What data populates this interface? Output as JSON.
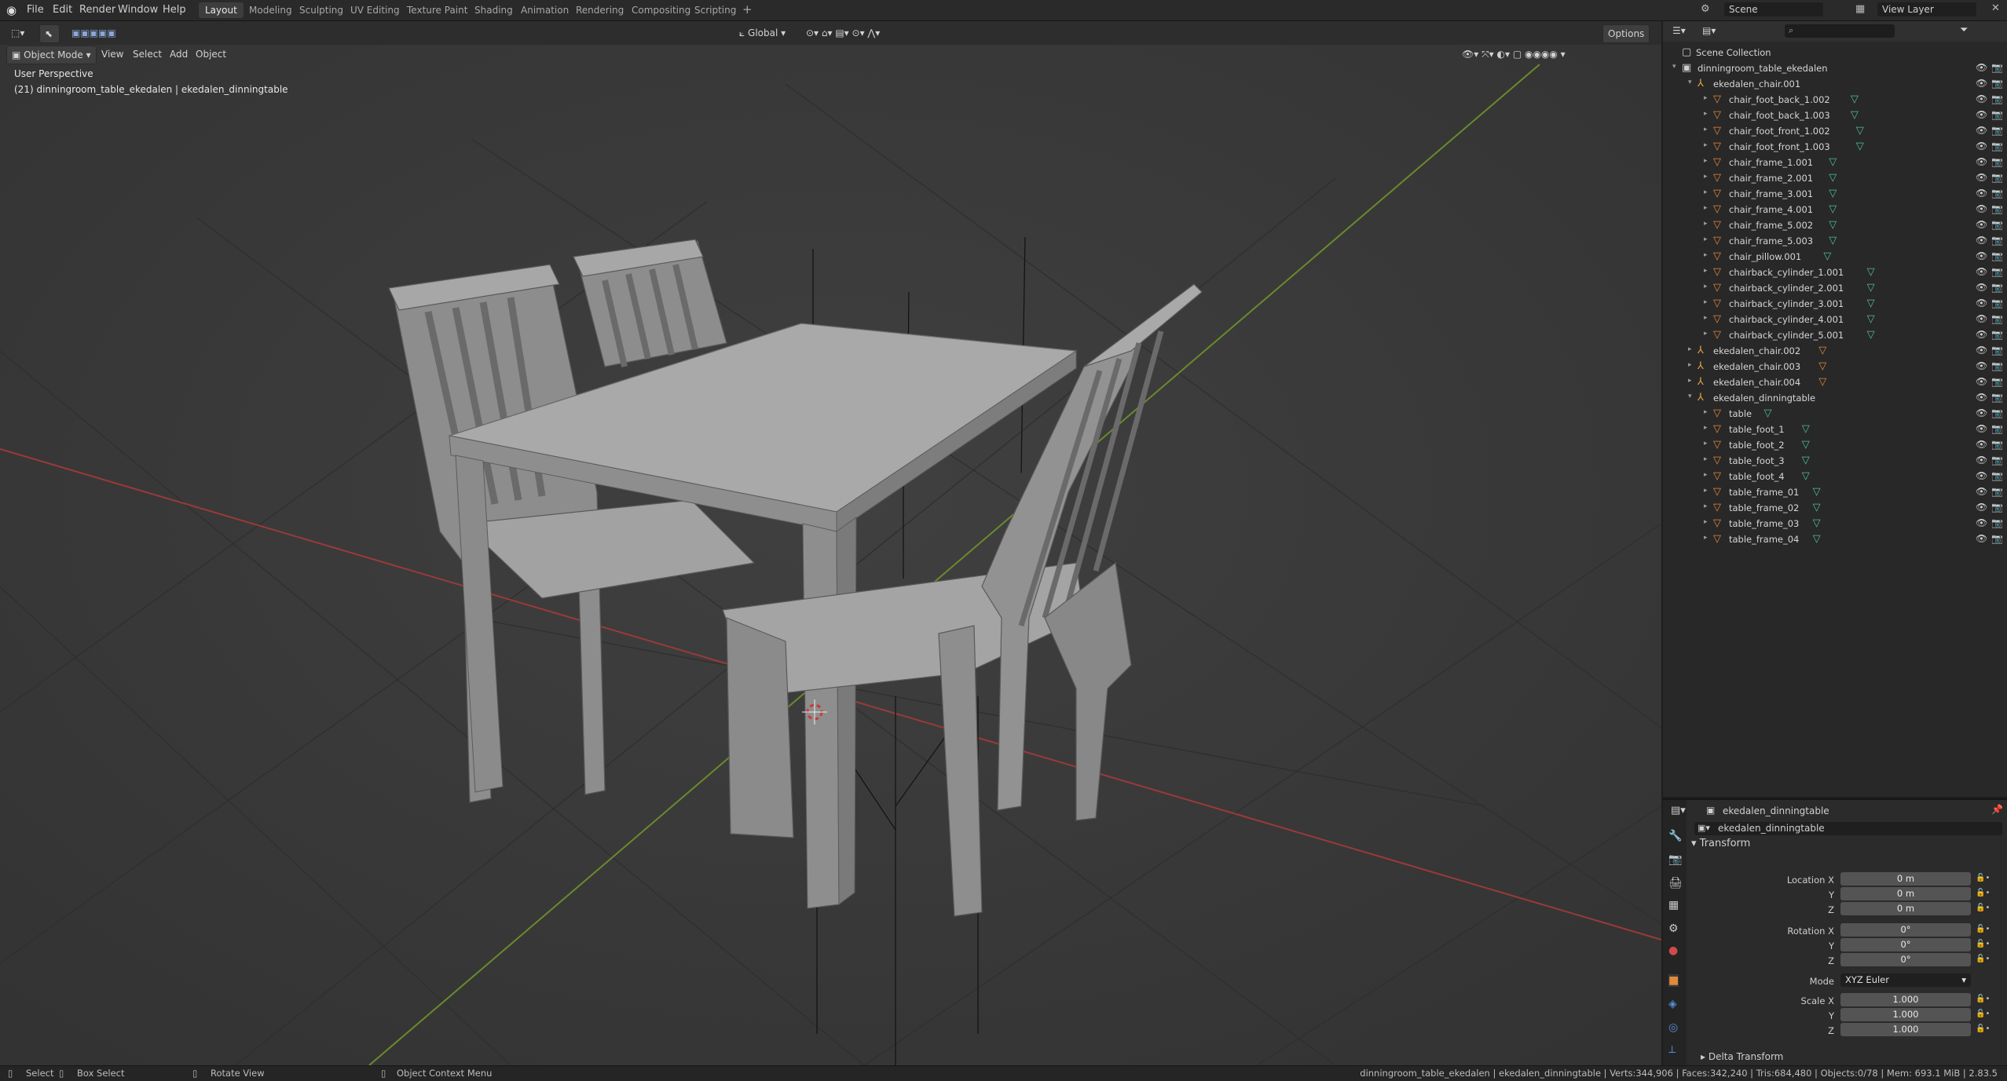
{
  "topbar": {
    "menus": [
      "File",
      "Edit",
      "Render",
      "Window",
      "Help"
    ],
    "workspaces": [
      "Layout",
      "Modeling",
      "Sculpting",
      "UV Editing",
      "Texture Paint",
      "Shading",
      "Animation",
      "Rendering",
      "Compositing",
      "Scripting"
    ],
    "active_workspace": "Layout",
    "scene_label": "Scene",
    "view_layer_label": "View Layer"
  },
  "viewport": {
    "mode": "Object Mode",
    "menus": [
      "View",
      "Select",
      "Add",
      "Object"
    ],
    "transform_orientation": "Global",
    "options_label": "Options",
    "perspective_label": "User Perspective",
    "active_info": "(21) dinningroom_table_ekedalen | ekedalen_dinningtable"
  },
  "outliner": {
    "root": "Scene Collection",
    "rows": [
      {
        "label": "dinningroom_table_ekedalen",
        "depth": 0,
        "type": "collection",
        "expanded": true
      },
      {
        "label": "ekedalen_chair.001",
        "depth": 1,
        "type": "empty",
        "expanded": true
      },
      {
        "label": "chair_foot_back_1.002",
        "depth": 2,
        "type": "mesh"
      },
      {
        "label": "chair_foot_back_1.003",
        "depth": 2,
        "type": "mesh"
      },
      {
        "label": "chair_foot_front_1.002",
        "depth": 2,
        "type": "mesh"
      },
      {
        "label": "chair_foot_front_1.003",
        "depth": 2,
        "type": "mesh"
      },
      {
        "label": "chair_frame_1.001",
        "depth": 2,
        "type": "mesh"
      },
      {
        "label": "chair_frame_2.001",
        "depth": 2,
        "type": "mesh"
      },
      {
        "label": "chair_frame_3.001",
        "depth": 2,
        "type": "mesh"
      },
      {
        "label": "chair_frame_4.001",
        "depth": 2,
        "type": "mesh"
      },
      {
        "label": "chair_frame_5.002",
        "depth": 2,
        "type": "mesh"
      },
      {
        "label": "chair_frame_5.003",
        "depth": 2,
        "type": "mesh"
      },
      {
        "label": "chair_pillow.001",
        "depth": 2,
        "type": "mesh"
      },
      {
        "label": "chairback_cylinder_1.001",
        "depth": 2,
        "type": "mesh"
      },
      {
        "label": "chairback_cylinder_2.001",
        "depth": 2,
        "type": "mesh"
      },
      {
        "label": "chairback_cylinder_3.001",
        "depth": 2,
        "type": "mesh"
      },
      {
        "label": "chairback_cylinder_4.001",
        "depth": 2,
        "type": "mesh"
      },
      {
        "label": "chairback_cylinder_5.001",
        "depth": 2,
        "type": "mesh"
      },
      {
        "label": "ekedalen_chair.002",
        "depth": 1,
        "type": "empty"
      },
      {
        "label": "ekedalen_chair.003",
        "depth": 1,
        "type": "empty"
      },
      {
        "label": "ekedalen_chair.004",
        "depth": 1,
        "type": "empty"
      },
      {
        "label": "ekedalen_dinningtable",
        "depth": 1,
        "type": "empty",
        "expanded": true
      },
      {
        "label": "table",
        "depth": 2,
        "type": "mesh"
      },
      {
        "label": "table_foot_1",
        "depth": 2,
        "type": "mesh"
      },
      {
        "label": "table_foot_2",
        "depth": 2,
        "type": "mesh"
      },
      {
        "label": "table_foot_3",
        "depth": 2,
        "type": "mesh"
      },
      {
        "label": "table_foot_4",
        "depth": 2,
        "type": "mesh"
      },
      {
        "label": "table_frame_01",
        "depth": 2,
        "type": "mesh"
      },
      {
        "label": "table_frame_02",
        "depth": 2,
        "type": "mesh"
      },
      {
        "label": "table_frame_03",
        "depth": 2,
        "type": "mesh"
      },
      {
        "label": "table_frame_04",
        "depth": 2,
        "type": "mesh"
      }
    ]
  },
  "properties": {
    "object_name": "ekedalen_dinningtable",
    "object_field": "ekedalen_dinningtable",
    "panel_title": "Transform",
    "location": {
      "label": "Location X",
      "x": "0 m",
      "y": "0 m",
      "z": "0 m"
    },
    "rotation": {
      "label": "Rotation X",
      "x": "0°",
      "y": "0°",
      "z": "0°"
    },
    "mode_label": "Mode",
    "mode_value": "XYZ Euler",
    "scale": {
      "label": "Scale X",
      "x": "1.000",
      "y": "1.000",
      "z": "1.000"
    },
    "axis_y": "Y",
    "axis_z": "Z",
    "delta_panel": "Delta Transform"
  },
  "statusbar": {
    "select": "Select",
    "box_select": "Box Select",
    "rotate_view": "Rotate View",
    "context_menu": "Object Context Menu",
    "stats": "dinningroom_table_ekedalen | ekedalen_dinningtable | Verts:344,906 | Faces:342,240 | Tris:684,480 | Objects:0/78 | Mem: 693.1 MiB | 2.83.5"
  },
  "colors": {
    "x_axis": "#a33c3c",
    "y_axis": "#6f8f2f",
    "selection": "#334d80",
    "mesh_icon": "#e08a3c",
    "data_icon": "#4fbf9a"
  }
}
